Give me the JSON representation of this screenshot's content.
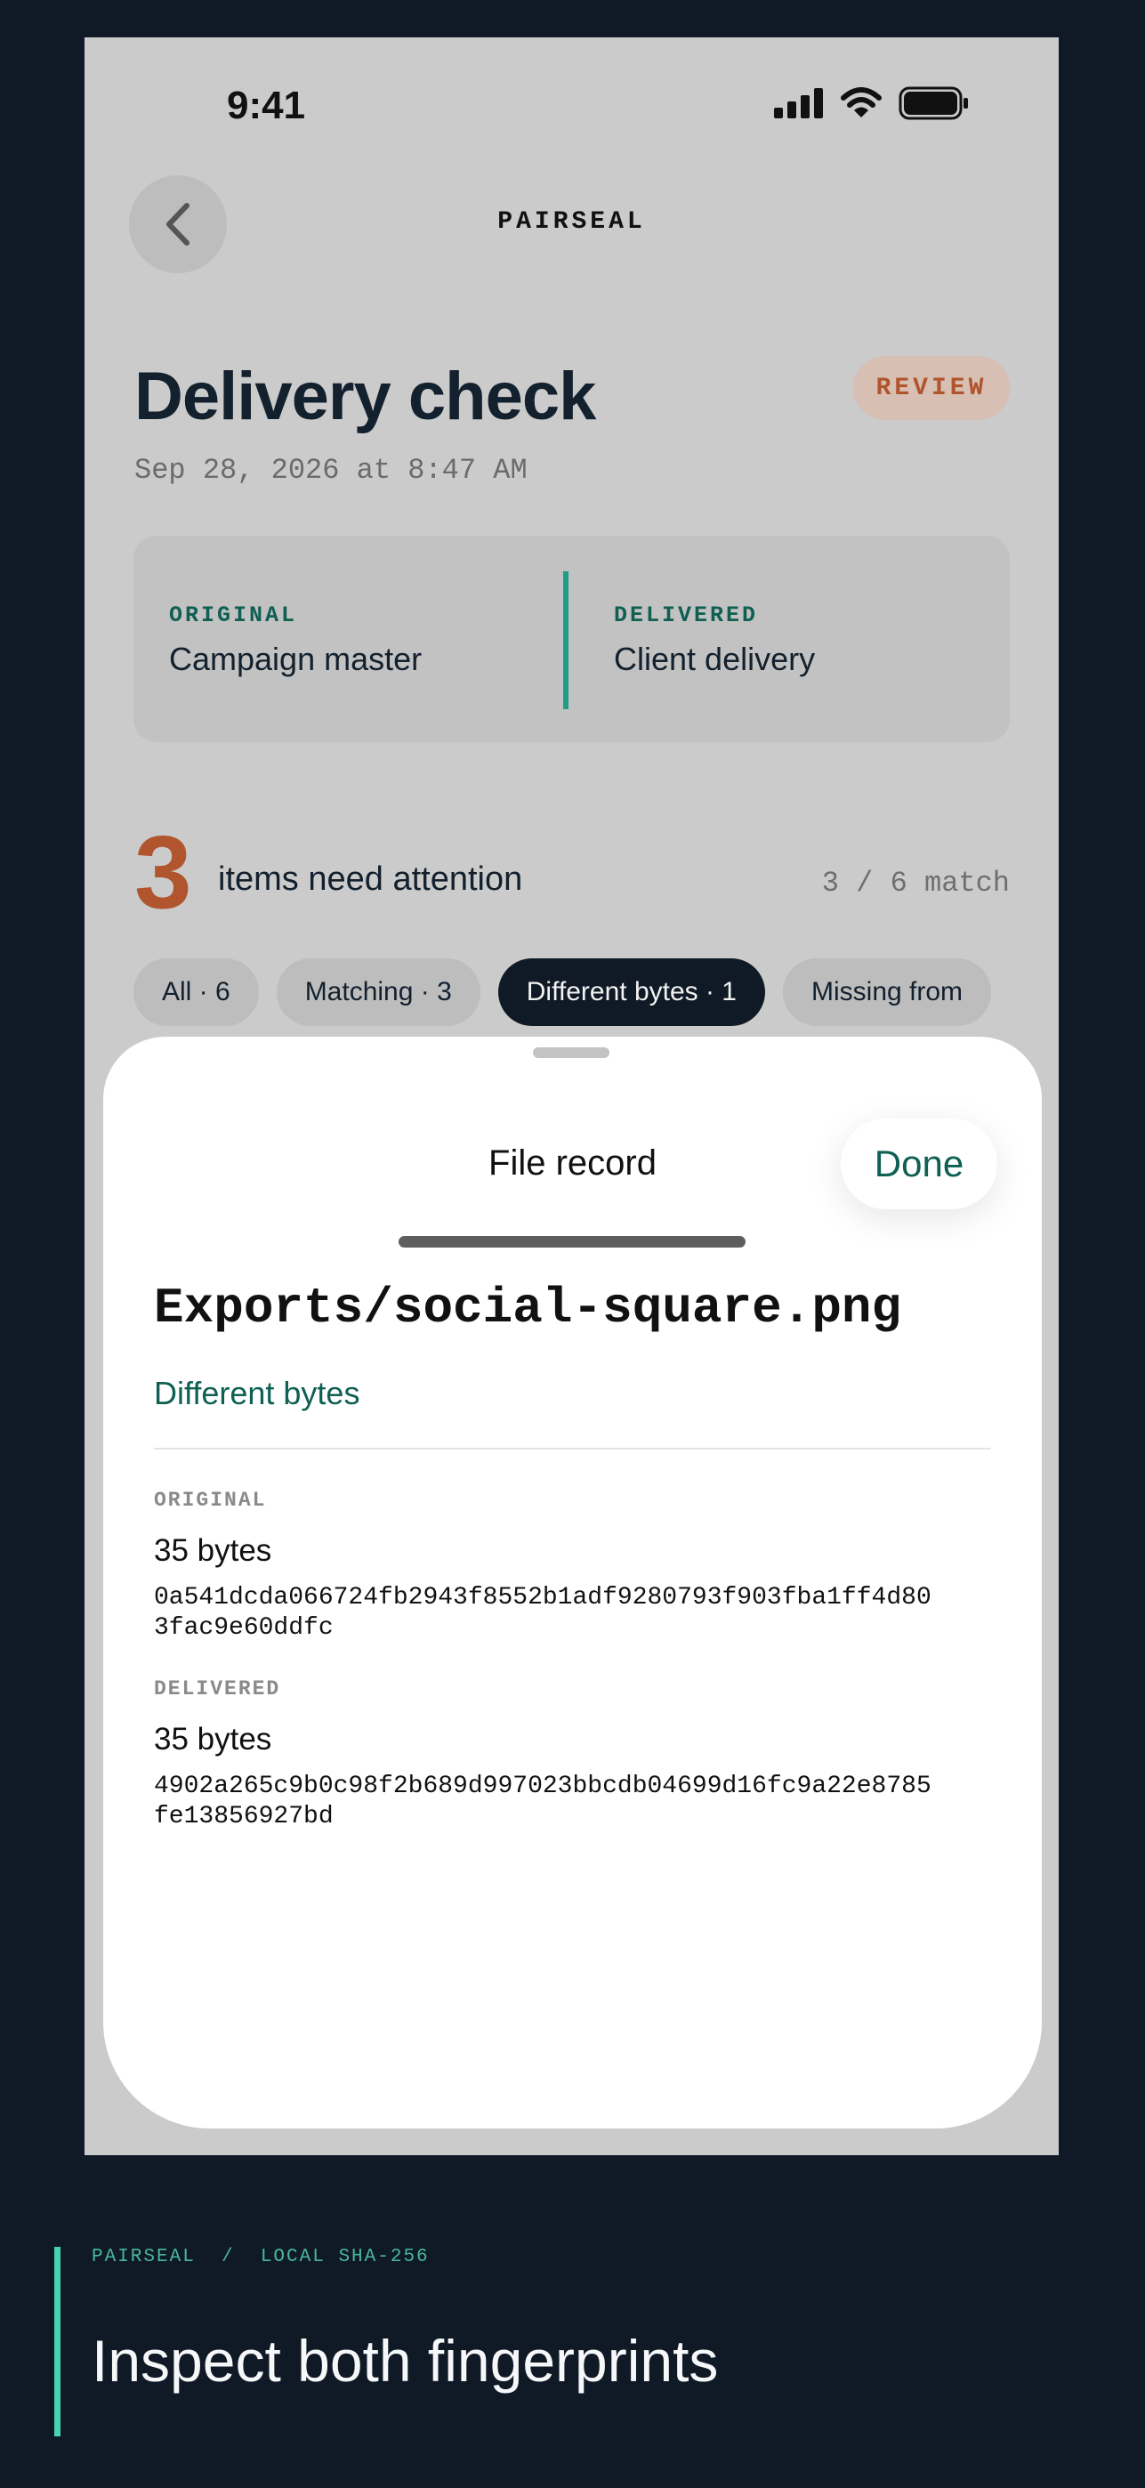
{
  "status_bar": {
    "time": "9:41"
  },
  "nav": {
    "app_title": "PAIRSEAL"
  },
  "page": {
    "title": "Delivery check",
    "status_badge": "REVIEW",
    "date": "Sep 28, 2026 at 8:47 AM"
  },
  "comparison": {
    "original": {
      "label": "ORIGINAL",
      "name": "Campaign master"
    },
    "delivered": {
      "label": "DELIVERED",
      "name": "Client delivery"
    }
  },
  "summary": {
    "attention_count": "3",
    "attention_label": "items need attention",
    "match_count": "3 / 6 match"
  },
  "filters": [
    {
      "label": "All · 6",
      "active": false
    },
    {
      "label": "Matching · 3",
      "active": false
    },
    {
      "label": "Different bytes · 1",
      "active": true
    },
    {
      "label": "Missing from",
      "active": false
    }
  ],
  "sheet": {
    "title": "File record",
    "done_label": "Done",
    "file_path": "Exports/social-square.png",
    "file_status": "Different bytes",
    "original": {
      "label": "ORIGINAL",
      "size": "35 bytes",
      "hash": "0a541dcda066724fb2943f8552b1adf9280793f903fba1ff4d80\n3fac9e60ddfc"
    },
    "delivered": {
      "label": "DELIVERED",
      "size": "35 bytes",
      "hash": "4902a265c9b0c98f2b689d997023bbcdb04699d16fc9a22e8785\nfe13856927bd"
    }
  },
  "caption": {
    "breadcrumb": "PAIRSEAL  /  LOCAL SHA-256",
    "title": "Inspect both fingerprints"
  },
  "colors": {
    "accent_teal": "#0f5f53",
    "review_orange": "#b0552e",
    "background_navy": "#0f1a26"
  }
}
